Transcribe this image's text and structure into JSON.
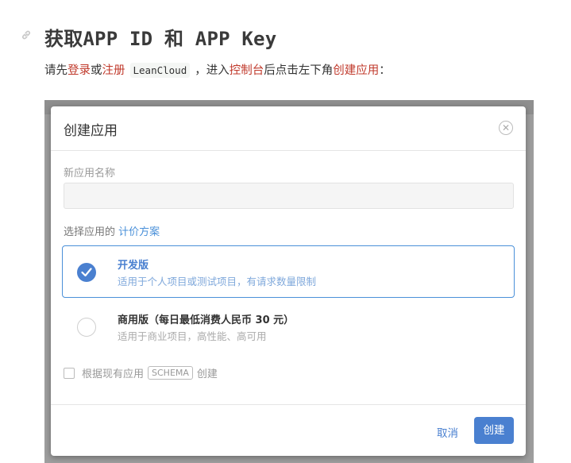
{
  "heading": {
    "title": "获取APP ID 和 APP Key",
    "icon": "link-icon"
  },
  "intro": {
    "text_1": "请先",
    "login_link": "登录",
    "text_2": "或",
    "register_link": "注册",
    "product_code": "LeanCloud",
    "text_3": "，进入",
    "console_link": "控制台",
    "text_4": "后点击左下角",
    "create_app_link": "创建应用",
    "text_5": "："
  },
  "dialog": {
    "title": "创建应用",
    "close_icon": "close-icon",
    "name_label": "新应用名称",
    "name_value": "",
    "plan_prompt": "选择应用的",
    "plan_link": "计价方案",
    "plans": [
      {
        "name": "开发版",
        "description": "适用于个人项目或测试项目，有请求数量限制",
        "selected": true
      },
      {
        "name": "商用版（每日最低消费人民币 30 元）",
        "description": "适用于商业项目，高性能、高可用",
        "selected": false
      }
    ],
    "schema_option": {
      "text_before": "根据现有应用",
      "tag": "SCHEMA",
      "text_after": "创建",
      "checked": false
    },
    "cancel_label": "取消",
    "create_label": "创建"
  },
  "colors": {
    "accent": "#4a80d0",
    "link_red": "#c0392b"
  }
}
